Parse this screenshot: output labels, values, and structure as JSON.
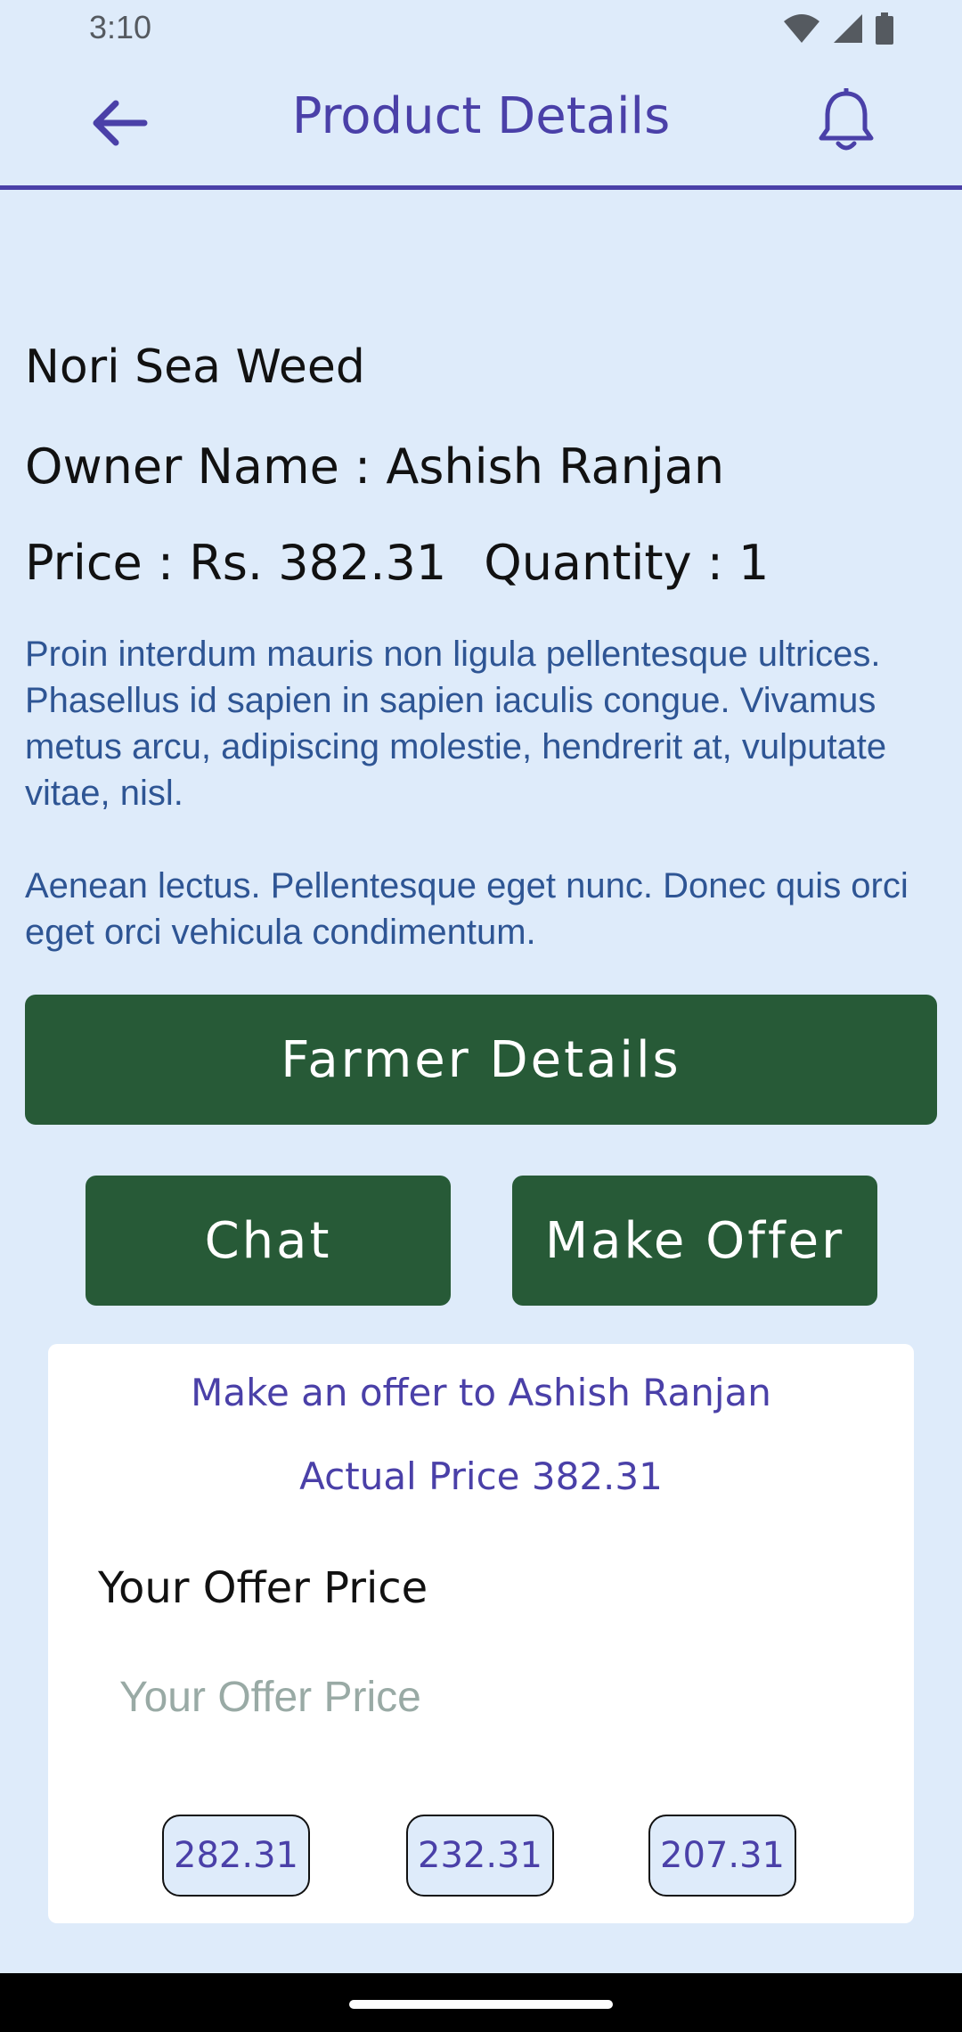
{
  "status_bar": {
    "time": "3:10",
    "icons": [
      "wifi-icon",
      "cellular-signal-icon",
      "battery-icon"
    ]
  },
  "app_bar": {
    "title": "Product Details",
    "back_icon": "back-arrow-icon",
    "bell_icon": "bell-icon"
  },
  "product": {
    "name": "Nori Sea Weed",
    "owner_line": "Owner Name : Ashish Ranjan",
    "price_text": "Price : Rs. 382.31",
    "quantity_text": "Quantity : 1",
    "description_p1": "Proin interdum mauris non ligula pellentesque ultrices. Phasellus id sapien in sapien iaculis congue. Vivamus metus arcu, adipiscing molestie, hendrerit at, vulputate vitae, nisl.",
    "description_p2": "Aenean lectus. Pellentesque eget nunc. Donec quis orci eget orci vehicula condimentum."
  },
  "buttons": {
    "farmer_details": "Farmer Details",
    "chat": "Chat",
    "make_offer": "Make Offer"
  },
  "offer_card": {
    "heading": "Make an offer to Ashish Ranjan",
    "actual_price": "Actual Price 382.31",
    "label": "Your Offer Price",
    "input_value": "",
    "input_placeholder": "Your Offer Price",
    "suggestions": [
      "282.31",
      "232.31",
      "207.31"
    ]
  },
  "colors": {
    "background": "#deebfa",
    "accent": "#4a40a8",
    "button_green": "#275a37",
    "description_text": "#2e5594"
  }
}
